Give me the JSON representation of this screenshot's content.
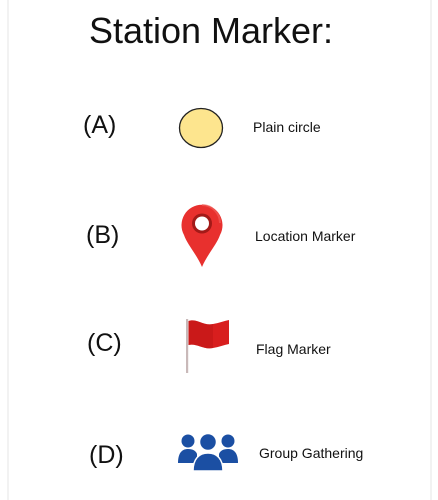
{
  "title": "Station Marker:",
  "markers": [
    {
      "letter": "(A)",
      "label": "Plain circle",
      "icon": "plain-circle-icon",
      "color": "#fde58e"
    },
    {
      "letter": "(B)",
      "label": "Location Marker",
      "icon": "location-pin-icon",
      "color": "#e8302e"
    },
    {
      "letter": "(C)",
      "label": "Flag Marker",
      "icon": "flag-icon",
      "color": "#d81e1e"
    },
    {
      "letter": "(D)",
      "label": "Group Gathering",
      "icon": "group-people-icon",
      "color": "#1b4fa3"
    }
  ]
}
